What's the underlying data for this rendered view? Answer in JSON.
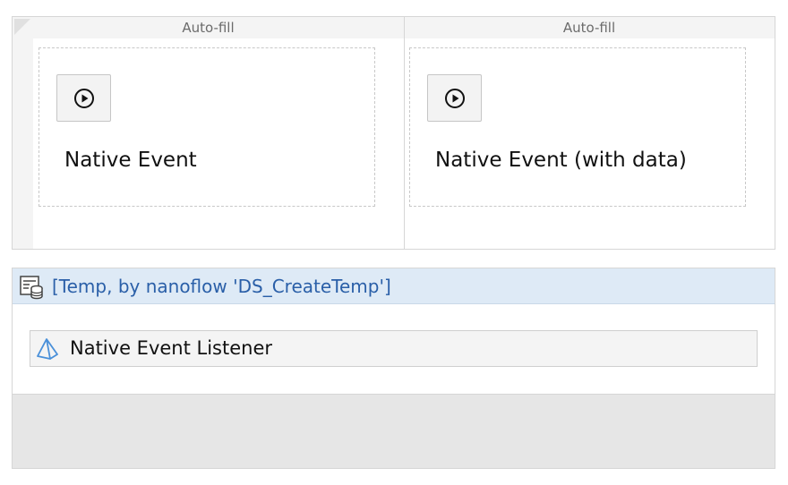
{
  "layout_grid": {
    "columns": [
      {
        "header": "Auto-fill",
        "button_icon": "play-circle-icon",
        "label": "Native Event"
      },
      {
        "header": "Auto-fill",
        "button_icon": "play-circle-icon",
        "label": "Native Event (with data)"
      }
    ]
  },
  "dataview": {
    "icon": "dataview-database-icon",
    "title": "[Temp, by nanoflow 'DS_CreateTemp']",
    "widget": {
      "icon": "pluggable-widget-pyramid-icon",
      "label": "Native Event Listener"
    }
  },
  "colors": {
    "dataview_header_bg": "#deeaf6",
    "dataview_title": "#2a5fa8",
    "widget_icon": "#4a90d9"
  }
}
